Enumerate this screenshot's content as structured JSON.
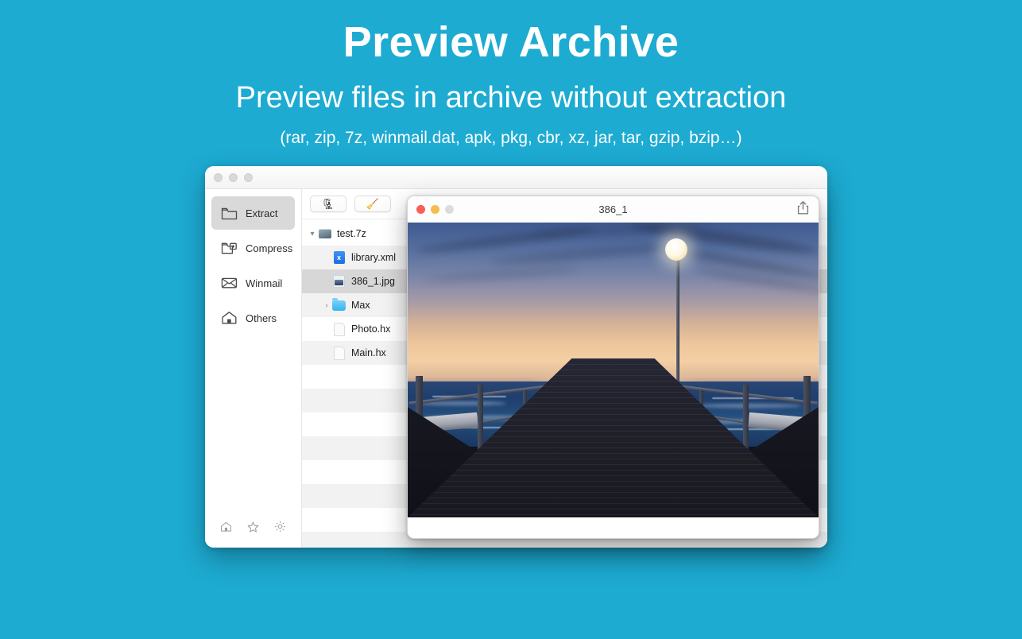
{
  "theme": {
    "background": "#1dabd2",
    "heading_color": "#ffffff"
  },
  "hero": {
    "title": "Preview Archive",
    "subtitle": "Preview files in archive without extraction",
    "formats": "(rar, zip, 7z, winmail.dat, apk, pkg, cbr, xz, jar, tar, gzip, bzip…)"
  },
  "app_window": {
    "traffic_lights": [
      "close",
      "minimize",
      "zoom"
    ],
    "sidebar": {
      "items": [
        {
          "label": "Extract",
          "icon": "folder-icon",
          "active": true
        },
        {
          "label": "Compress",
          "icon": "folder-plus-icon",
          "active": false
        },
        {
          "label": "Winmail",
          "icon": "envelope-icon",
          "active": false
        },
        {
          "label": "Others",
          "icon": "house-icon",
          "active": false
        }
      ],
      "bottom_icons": [
        "home-icon",
        "star-icon",
        "gear-icon"
      ]
    },
    "toolbar": {
      "buttons": [
        {
          "name": "extract-button",
          "icon": "extract-archive-icon",
          "glyph": "🗜"
        },
        {
          "name": "clean-button",
          "icon": "broom-icon",
          "glyph": "🧹"
        }
      ]
    },
    "file_list": {
      "rows": [
        {
          "label": "test.7z",
          "icon": "archive-icon",
          "depth": 0,
          "twisty": "▾",
          "selected": false,
          "striped": false
        },
        {
          "label": "library.xml",
          "icon": "xml-file-icon",
          "depth": 1,
          "twisty": "",
          "selected": false,
          "striped": true
        },
        {
          "label": "386_1.jpg",
          "icon": "image-file-icon",
          "depth": 1,
          "twisty": "",
          "selected": true,
          "striped": false
        },
        {
          "label": "Max",
          "icon": "folder-icon",
          "depth": 1,
          "twisty": "›",
          "selected": false,
          "striped": true
        },
        {
          "label": "Photo.hx",
          "icon": "document-icon",
          "depth": 1,
          "twisty": "",
          "selected": false,
          "striped": false
        },
        {
          "label": "Main.hx",
          "icon": "document-icon",
          "depth": 1,
          "twisty": "",
          "selected": false,
          "striped": true
        }
      ],
      "empty_rows": [
        false,
        false,
        true,
        false,
        true,
        false,
        true,
        false,
        true
      ]
    }
  },
  "preview_window": {
    "title": "386_1",
    "traffic_lights": [
      {
        "name": "close-button",
        "color": "#fc5d57"
      },
      {
        "name": "minimize-button",
        "color": "#f5bd4f"
      },
      {
        "name": "zoom-button",
        "color": "#dcdcdc"
      }
    ],
    "share_icon": "share-icon",
    "image_description": "Wooden pier at sunset with lamp posts over the sea"
  }
}
